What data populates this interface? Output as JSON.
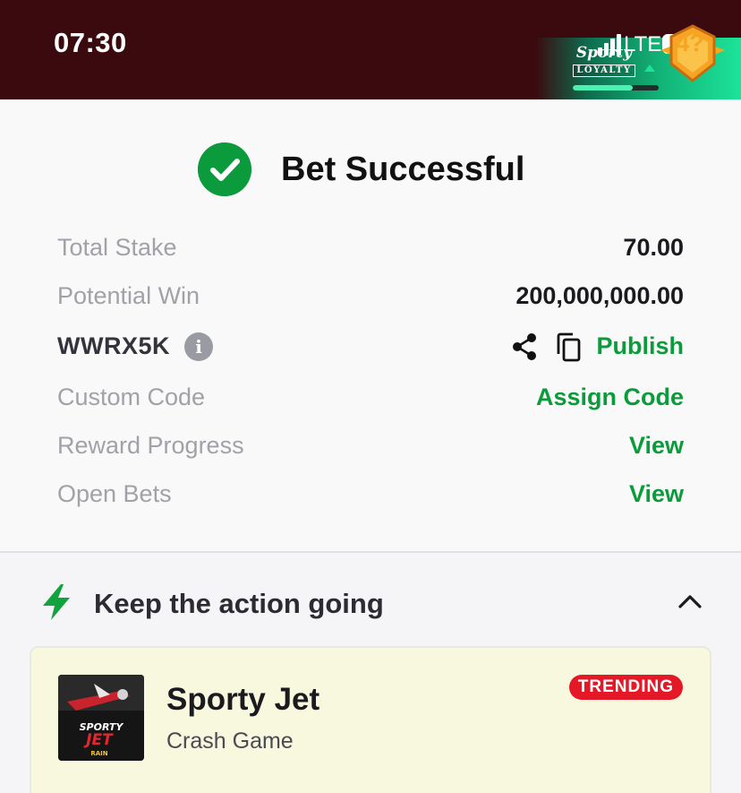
{
  "status_bar": {
    "time": "07:30",
    "network": "LTE",
    "loyalty_logo_line1": "Sporty",
    "loyalty_logo_line2": "LOYALTY",
    "loyalty_progress_fraction": 0.7,
    "badge_level": "4?"
  },
  "bet_result": {
    "title": "Bet Successful",
    "rows": [
      {
        "label": "Total Stake",
        "value": "70.00"
      },
      {
        "label": "Potential Win",
        "value": "200,000,000.00"
      }
    ],
    "booking_code": "WWRX5K",
    "info_glyph": "i",
    "publish_label": "Publish",
    "custom_code_label": "Custom Code",
    "assign_code_label": "Assign Code",
    "reward_progress_label": "Reward Progress",
    "reward_progress_link": "View",
    "open_bets_label": "Open Bets",
    "open_bets_link": "View"
  },
  "action_section": {
    "title": "Keep the action going",
    "game": {
      "name": "Sporty Jet",
      "category": "Crash Game",
      "badge": "TRENDING",
      "thumb_text_1": "SPORTY",
      "thumb_text_2": "JET",
      "thumb_text_3": "RAIN"
    }
  },
  "colors": {
    "accent_green": "#0c9b3a",
    "status_bar_bg": "#3b0a0f",
    "trending_red": "#e41827"
  }
}
